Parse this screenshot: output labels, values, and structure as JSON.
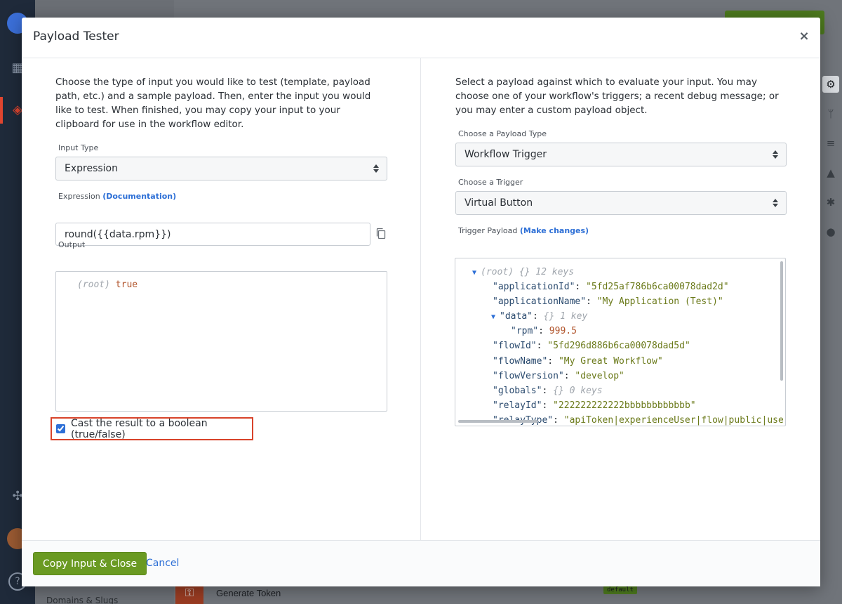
{
  "background": {
    "generate_token_label": "Generate Token",
    "default_badge": "default",
    "domains_label": "Domains & Slugs"
  },
  "modal": {
    "title": "Payload Tester",
    "close_icon": "×"
  },
  "left": {
    "intro": "Choose the type of input you would like to test (template, payload path, etc.) and a sample payload. Then, enter the input you would like to test. When finished, you may copy your input to your clipboard for use in the workflow editor.",
    "input_type_label": "Input Type",
    "input_type_value": "Expression",
    "expression_label": "Expression",
    "documentation_link": "(Documentation)",
    "expression_value": "round({{data.rpm}})",
    "output_label": "Output",
    "output_root": "(root)",
    "output_value": "true",
    "cast_label": "Cast the result to a boolean (true/false)",
    "cast_checked": true
  },
  "right": {
    "intro": "Select a payload against which to evaluate your input. You may choose one of your workflow's triggers; a recent debug message; or you may enter a custom payload object.",
    "payload_type_label": "Choose a Payload Type",
    "payload_type_value": "Workflow Trigger",
    "trigger_label": "Choose a Trigger",
    "trigger_value": "Virtual Button",
    "trigger_payload_label": "Trigger Payload",
    "make_changes_link": "(Make changes)",
    "json": {
      "root_label": "(root)",
      "root_meta": "{}  12 keys",
      "applicationId_key": "\"applicationId\"",
      "applicationId_val": "\"5fd25af786b6ca00078dad2d\"",
      "applicationName_key": "\"applicationName\"",
      "applicationName_val": "\"My Application (Test)\"",
      "data_key": "\"data\"",
      "data_meta": "{}  1 key",
      "rpm_key": "\"rpm\"",
      "rpm_val": "999.5",
      "flowId_key": "\"flowId\"",
      "flowId_val": "\"5fd296d886b6ca00078dad5d\"",
      "flowName_key": "\"flowName\"",
      "flowName_val": "\"My Great Workflow\"",
      "flowVersion_key": "\"flowVersion\"",
      "flowVersion_val": "\"develop\"",
      "globals_key": "\"globals\"",
      "globals_meta": "{}  0 keys",
      "relayId_key": "\"relayId\"",
      "relayId_val": "\"222222222222bbbbbbbbbbbb\"",
      "relayType_key": "\"relayType\"",
      "relayType_val": "\"apiToken|experienceUser|flow|public|user\""
    }
  },
  "footer": {
    "copy_button": "Copy Input & Close",
    "cancel_button": "Cancel"
  }
}
